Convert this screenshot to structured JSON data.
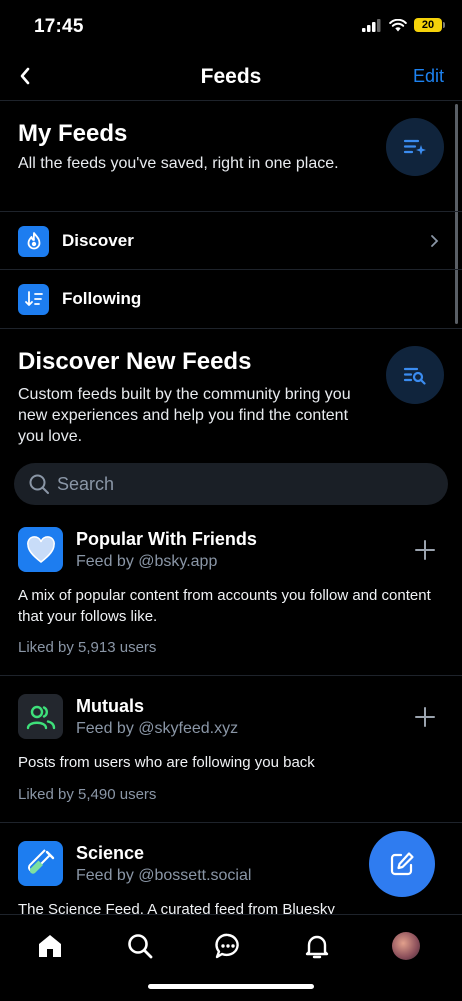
{
  "status_bar": {
    "time": "17:45",
    "battery": "20"
  },
  "header": {
    "title": "Feeds",
    "edit_label": "Edit"
  },
  "my_feeds": {
    "title": "My Feeds",
    "description": "All the feeds you've saved, right in one place.",
    "items": [
      {
        "label": "Discover",
        "icon": "flame-icon"
      },
      {
        "label": "Following",
        "icon": "sort-list-icon"
      }
    ]
  },
  "discover_new": {
    "title": "Discover New Feeds",
    "description": "Custom feeds built by the community bring you new experiences and help you find the content you love."
  },
  "search": {
    "placeholder": "Search"
  },
  "feeds": [
    {
      "name": "Popular With Friends",
      "by": "Feed by @bsky.app",
      "description": "A mix of popular content from accounts you follow and content that your follows like.",
      "likes": "Liked by 5,913 users"
    },
    {
      "name": "Mutuals",
      "by": "Feed by @skyfeed.xyz",
      "description": "Posts from users who are following you back",
      "likes": "Liked by 5,490 users"
    },
    {
      "name": "Science",
      "by": "Feed by @bossett.social",
      "description": "The Science Feed. A curated feed from Bluesky"
    }
  ],
  "colors": {
    "accent": "#1d82f0",
    "background": "#000000",
    "muted": "#8a96a6"
  }
}
